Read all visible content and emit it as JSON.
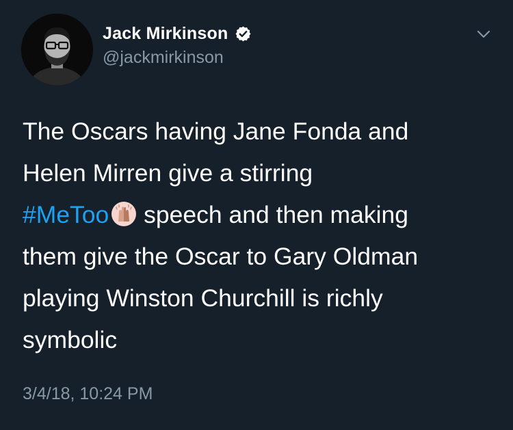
{
  "author": {
    "display_name": "Jack Mirkinson",
    "handle": "@jackmirkinson",
    "verified": true,
    "avatar_icon": "profile-photo"
  },
  "menu": {
    "icon": "chevron-down-icon"
  },
  "tweet": {
    "lines": {
      "l1": "The Oscars having Jane Fonda and",
      "l2": "Helen Mirren give a stirring",
      "l3_hashtag": "#MeToo",
      "l3_rest": " speech and then making",
      "l4": "them give the Oscar to Gary Oldman",
      "l5": "playing Winston Churchill is richly",
      "l6": "symbolic"
    },
    "emoji": "raised-hands-emoji",
    "timestamp": "3/4/18, 10:24 PM"
  },
  "colors": {
    "background": "#15202b",
    "primary_text": "#ffffff",
    "secondary_text": "#8899a6",
    "link": "#1da1f2"
  }
}
